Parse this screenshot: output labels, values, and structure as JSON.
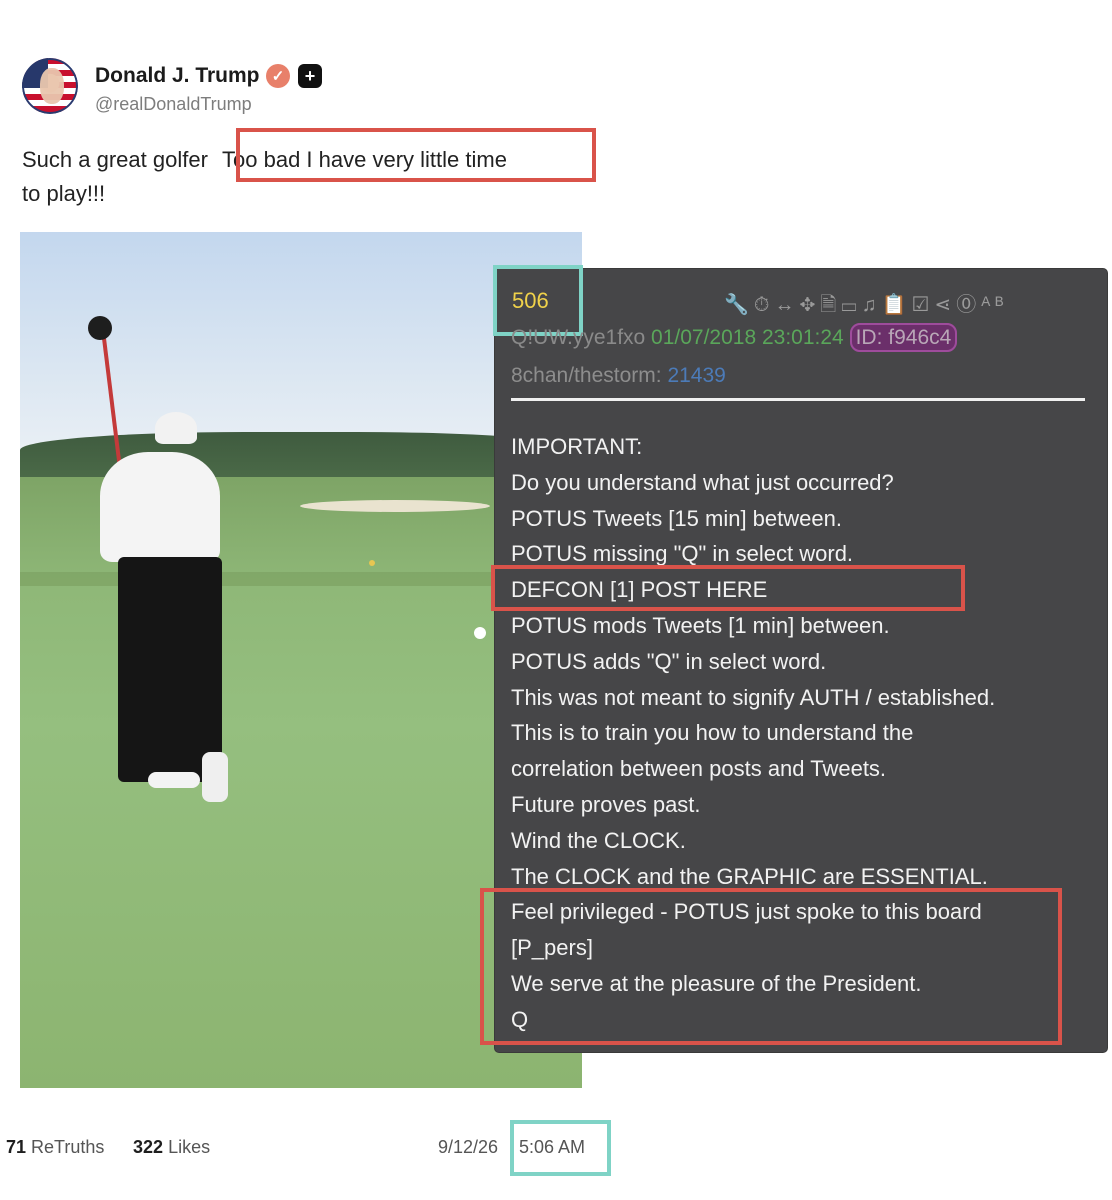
{
  "user": {
    "name": "Donald J. Trump",
    "handle": "@realDonaldTrump",
    "verified_symbol": "✓",
    "plus_symbol": "+"
  },
  "post": {
    "text_part1": "Such a great golfer",
    "text_highlight": "Too bad I have very little time",
    "text_part2": "to play!!!"
  },
  "q_post": {
    "number": "506",
    "tripcode": "Q!UW.yye1fxo",
    "datetime": "01/07/2018 23:01:24",
    "id_label": "ID: f946c4",
    "board": "8chan/thestorm:",
    "board_num": "21439",
    "icons": "🔧⏱↔✥🗎▭♫📋☑⋖⓪ᴬᴮ",
    "lines": [
      "IMPORTANT:",
      "Do you understand what just occurred?",
      "POTUS Tweets [15 min] between.",
      "POTUS missing \"Q\" in select word.",
      "DEFCON [1] POST HERE",
      "POTUS mods Tweets [1 min] between.",
      "POTUS adds \"Q\" in select word.",
      "This was not meant to signify AUTH / established.",
      "This is to train you how to understand the",
      "correlation between posts and Tweets.",
      "Future proves past.",
      "Wind the CLOCK.",
      "The CLOCK and the GRAPHIC are ESSENTIAL.",
      "Feel privileged - POTUS just spoke to this board",
      "[P_pers]",
      "We serve at the pleasure of the President.",
      "Q"
    ]
  },
  "footer": {
    "retruths_count": "71",
    "retruths_label": "ReTruths",
    "likes_count": "322",
    "likes_label": "Likes",
    "date": "9/12/26",
    "time": "5:06 AM"
  },
  "colors": {
    "highlight_red": "#d9534a",
    "highlight_teal": "#7fd3c6",
    "panel_bg": "#464648",
    "q_number": "#f0d24a",
    "date_green": "#5aa65a"
  }
}
